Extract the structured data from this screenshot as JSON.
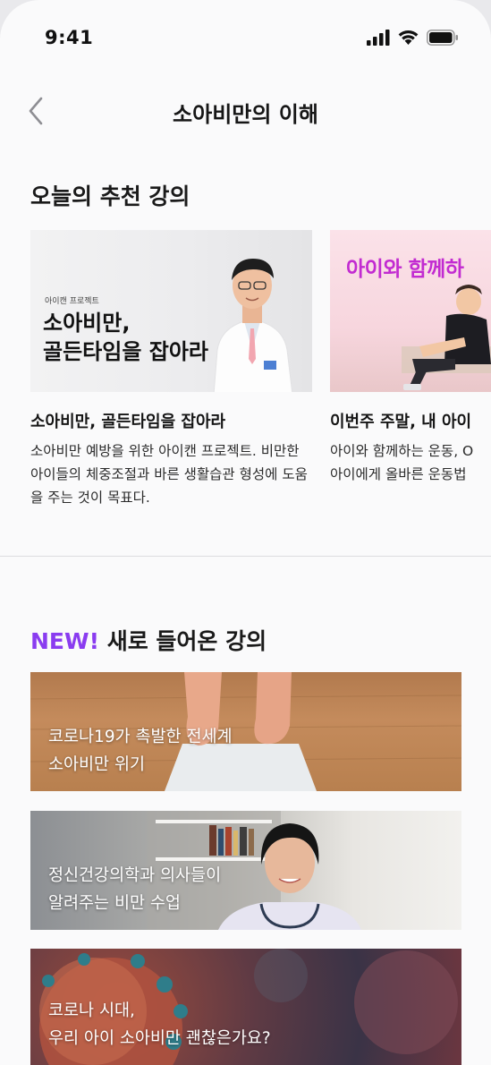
{
  "status": {
    "time": "9:41"
  },
  "nav": {
    "title": "소아비만의 이해"
  },
  "recommended": {
    "title": "오늘의 추천 강의",
    "cards": [
      {
        "thumb_tag": "아이캔 프로젝트",
        "thumb_line1": "소아비만,",
        "thumb_line2": "골든타임을 잡아라",
        "title": "소아비만, 골든타임을 잡아라",
        "desc": "소아비만 예방을 위한 아이캔 프로젝트. 비만한 아이들의 체중조절과 바른 생활습관 형성에 도움을 주는 것이 목표다."
      },
      {
        "thumb_text": "아이와 함께하",
        "title": "이번주 주말, 내 아이",
        "desc_line1": "아이와 함께하는 운동, O",
        "desc_line2": "아이에게 올바른 운동법"
      }
    ]
  },
  "new_section": {
    "badge": "NEW!",
    "title": "새로 들어온 강의",
    "items": [
      {
        "line1": "코로나19가 촉발한 전세계",
        "line2": "소아비만 위기"
      },
      {
        "line1": "정신건강의학과 의사들이",
        "line2": "알려주는 비만 수업"
      },
      {
        "line1": "코로나 시대,",
        "line2": "우리 아이 소아비만 괜찮은가요?"
      }
    ]
  },
  "colors": {
    "accent": "#8a3cf0",
    "pink_title": "#c22bd1"
  },
  "icons": [
    "signal-icon",
    "wifi-icon",
    "battery-icon",
    "back-chevron-icon"
  ]
}
